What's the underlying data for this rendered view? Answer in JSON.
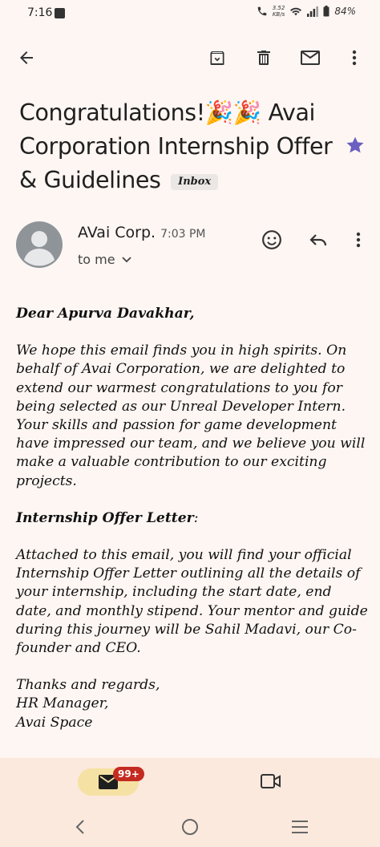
{
  "status": {
    "time": "7:16",
    "net_speed": "3.52",
    "net_unit": "KB/s",
    "battery": "84%"
  },
  "toolbar": {
    "icons": [
      "back-arrow-icon",
      "archive-icon",
      "delete-icon",
      "mail-icon",
      "more-vert-icon"
    ]
  },
  "email": {
    "subject": "Congratulations!🎉🎉 Avai Corporation Internship Offer & Guidelines",
    "label": "Inbox",
    "starred": true,
    "sender": "AVai Corp.",
    "time": "7:03 PM",
    "recipient": "to me",
    "body": {
      "greeting": "Dear Apurva Davakhar,",
      "p1": "We hope this email finds you in high spirits. On behalf of Avai Corporation, we are delighted to extend our warmest congratulations to you for being selected as our Unreal Developer Intern. Your skills and passion for game development have impressed our team, and we believe you will make a valuable contribution to our exciting projects.",
      "heading": "Internship Offer Letter",
      "heading_suffix": ":",
      "p2": "Attached to this email, you will find your official Internship Offer Letter outlining all the details of your internship, including the start date, end date, and monthly stipend. Your mentor and guide during this journey will be Sahil Madavi, our Co-founder and CEO.",
      "sign1": "Thanks and regards,",
      "sign2": "HR Manager,",
      "sign3": "Avai Space"
    }
  },
  "bottom_nav": {
    "badge": "99+"
  },
  "colors": {
    "background": "#fdf6f3",
    "nav_bg": "#fbe9dd",
    "pill": "#f5e1a3",
    "badge": "#c42b20",
    "star": "#6b5fc0"
  }
}
